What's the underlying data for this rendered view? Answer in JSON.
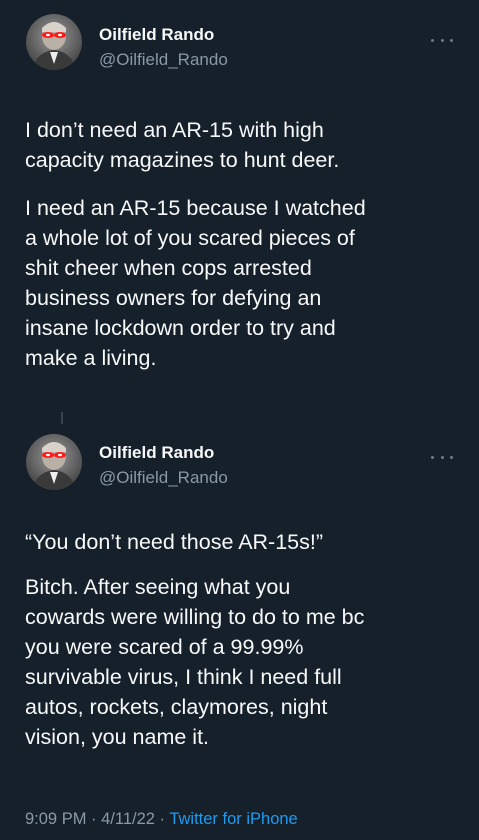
{
  "tweets": [
    {
      "author": {
        "name": "Oilfield Rando",
        "handle": "@Oilfield_Rando",
        "avatar_icon": "profile-photo-laser-eyes"
      },
      "more_icon": "more-options-icon",
      "paragraphs": [
        "I don’t need an AR-15 with high\ncapacity magazines to hunt deer.",
        "I need an AR-15 because I watched\na whole lot of you scared pieces of\nshit cheer when cops arrested\nbusiness owners for defying an\ninsane lockdown order to try and\nmake a living."
      ]
    },
    {
      "author": {
        "name": "Oilfield Rando",
        "handle": "@Oilfield_Rando",
        "avatar_icon": "profile-photo-laser-eyes"
      },
      "more_icon": "more-options-icon",
      "paragraphs": [
        "“You don’t need those AR-15s!”",
        "Bitch. After seeing what you\ncowards were willing to do to me bc\nyou were scared of a 99.99%\nsurvivable virus, I think I need full\nautos, rockets, claymores, night\nvision, you name it."
      ],
      "timestamp": {
        "time": "9:09 PM",
        "separator": " · ",
        "date": "4/11/22",
        "source": "Twitter for iPhone"
      }
    }
  ],
  "colors": {
    "background": "#15202b",
    "text_primary": "#f7f9f9",
    "text_secondary": "#8b98a5",
    "link": "#1d9bf0",
    "laser_eyes": "#ff1a1a"
  }
}
